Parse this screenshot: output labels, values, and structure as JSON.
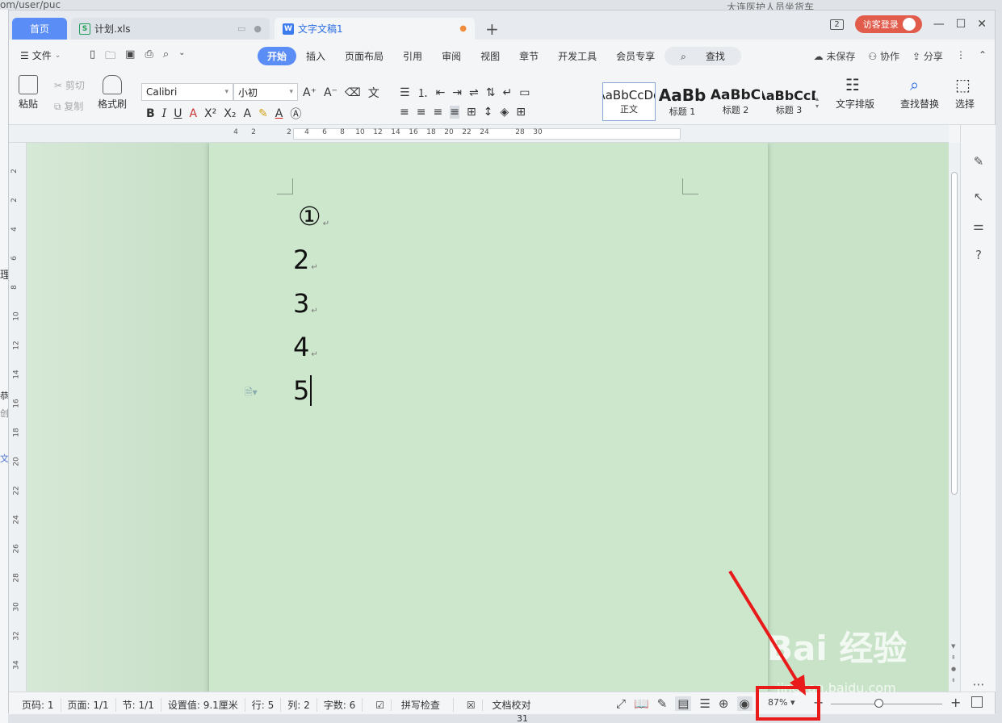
{
  "background": {
    "url_fragment": "om/user/puc",
    "right_text": "大连医护人员坐货车",
    "left_fragments": [
      "理",
      "恭",
      "创",
      "文"
    ],
    "bottom_number": "31"
  },
  "tabs": [
    {
      "label": "首页"
    },
    {
      "label": "计划.xls"
    },
    {
      "label": "文字文稿1"
    }
  ],
  "window": {
    "badge": "2",
    "login_label": "访客登录"
  },
  "menu": {
    "file_label": "文件",
    "items": [
      "开始",
      "插入",
      "页面布局",
      "引用",
      "审阅",
      "视图",
      "章节",
      "开发工具",
      "会员专享"
    ],
    "search_label": "查找",
    "right": [
      "未保存",
      "协作",
      "分享"
    ]
  },
  "ribbon": {
    "paste": "粘贴",
    "cut": "剪切",
    "copy": "复制",
    "format_painter": "格式刷",
    "font_name": "Calibri",
    "font_size": "小初",
    "styles": [
      {
        "preview": "AaBbCcDd",
        "label": "正文"
      },
      {
        "preview": "AaBb",
        "label": "标题 1"
      },
      {
        "preview": "AaBbC",
        "label": "标题 2"
      },
      {
        "preview": "AaBbCcD",
        "label": "标题 3"
      }
    ],
    "text_layout": "文字排版",
    "find_replace": "查找替换",
    "select": "选择"
  },
  "ruler": {
    "h_numbers": [
      "4",
      "2",
      "",
      "2",
      "4",
      "6",
      "8",
      "10",
      "12",
      "14",
      "16",
      "18",
      "20",
      "22",
      "24",
      "",
      "28",
      "30"
    ],
    "v_numbers": [
      "2",
      "2",
      "4",
      "6",
      "8",
      "10",
      "12",
      "14",
      "16",
      "18",
      "20",
      "22",
      "24",
      "26",
      "28",
      "30",
      "32",
      "34"
    ]
  },
  "document": {
    "lines": [
      "①",
      "2",
      "3",
      "4",
      "5"
    ]
  },
  "status": {
    "page_num": "页码: 1",
    "pages": "页面: 1/1",
    "section": "节: 1/1",
    "setting": "设置值: 9.1厘米",
    "row": "行: 5",
    "col": "列: 2",
    "words": "字数: 6",
    "spell": "拼写检查",
    "proof": "文档校对",
    "zoom": "87%"
  },
  "watermark": {
    "brand": "Bai  经验",
    "site": "jingyan.baidu.com"
  },
  "colors": {
    "accent": "#5b8df6",
    "page_bg": "#cde7cd",
    "highlight": "#e81a1a"
  }
}
